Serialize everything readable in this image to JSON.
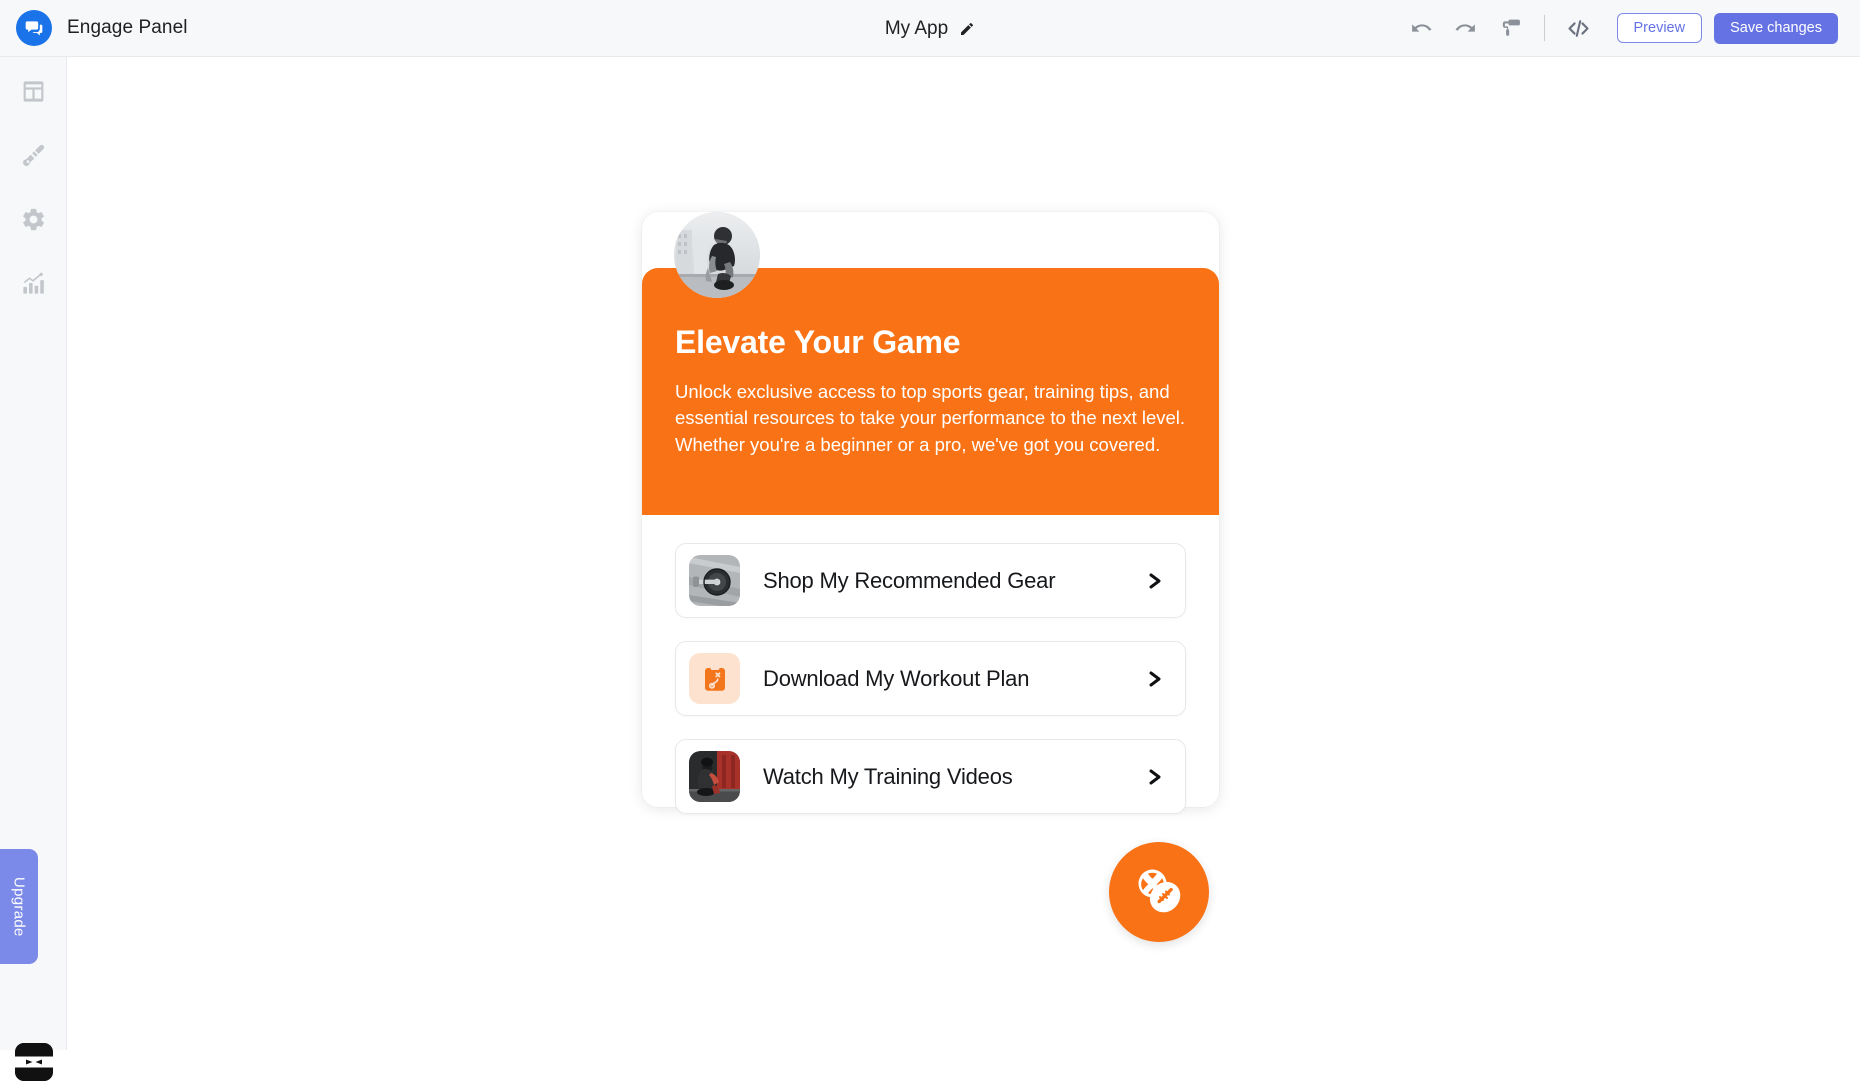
{
  "header": {
    "brand_name": "Engage Panel",
    "brand_logo_icon": "chat-bubble-icon",
    "app_title": "My App",
    "edit_icon": "pencil-icon",
    "undo_icon": "undo-arrow-icon",
    "redo_icon": "redo-arrow-icon",
    "theme_icon": "paint-roller-icon",
    "code_icon": "code-brackets-icon",
    "preview_label": "Preview",
    "save_label": "Save changes",
    "accent_color": "#6572e4",
    "logo_color": "#1a73e8"
  },
  "sidebar": {
    "items": [
      {
        "name": "blocks",
        "icon": "layout-grid-icon"
      },
      {
        "name": "design",
        "icon": "paintbrush-icon"
      },
      {
        "name": "settings",
        "icon": "gear-icon"
      },
      {
        "name": "analytics",
        "icon": "bar-chart-icon"
      }
    ],
    "upgrade_label": "Upgrade",
    "upgrade_color": "#7b89e8",
    "avatar_icon": "ninja-face-avatar"
  },
  "page": {
    "avatar_alt": "athlete-tying-shoes-photo",
    "hero_bg_color": "#f97316",
    "hero_title": "Elevate Your Game",
    "hero_description": "Unlock exclusive access to top sports gear, training tips, and essential resources to take your performance to the next level. Whether you're a beginner or a pro, we've got you covered.",
    "links": [
      {
        "label": "Shop My Recommended Gear",
        "thumb": "barbell-weight-photo",
        "chevron": "chevron-right-icon"
      },
      {
        "label": "Download My Workout Plan",
        "thumb": "clipboard-playbook-icon",
        "chevron": "chevron-right-icon"
      },
      {
        "label": "Watch My Training Videos",
        "thumb": "gym-training-photo",
        "chevron": "chevron-right-icon"
      }
    ],
    "fab_icon": "sports-balls-icon",
    "fab_color": "#f97316"
  }
}
